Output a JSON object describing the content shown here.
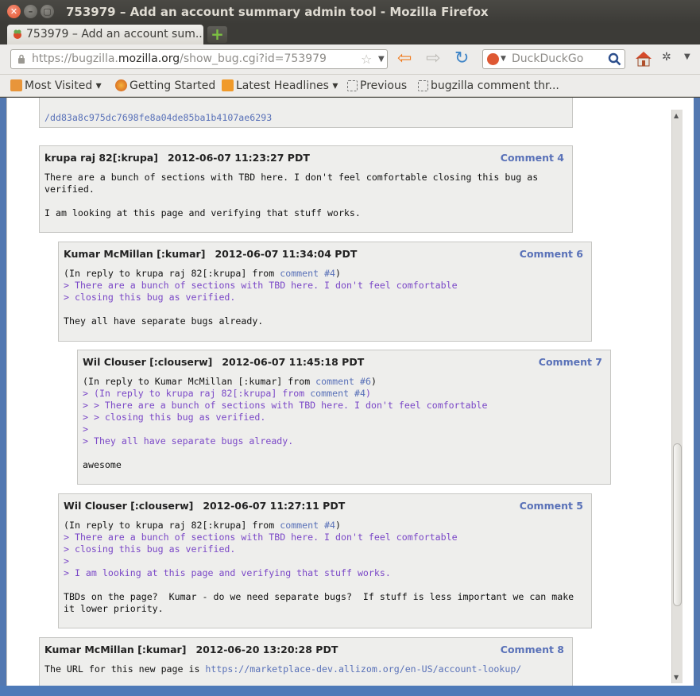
{
  "window": {
    "title": "753979 – Add an account summary admin tool - Mozilla Firefox",
    "close_glyph": "✕",
    "min_glyph": "–",
    "max_glyph": "▢"
  },
  "tabs": [
    {
      "label": "753979 – Add an account sum..."
    }
  ],
  "new_tab_glyph": "+",
  "navbar": {
    "url_prefix": "https://bugzilla.",
    "url_domain": "mozilla.org",
    "url_path": "/show_bug.cgi?id=753979",
    "search_placeholder": "DuckDuckGo"
  },
  "bookmarks": [
    {
      "label": "Most Visited ▾",
      "icon": "rss-folder-icon"
    },
    {
      "label": "Getting Started",
      "icon": "firefox-icon"
    },
    {
      "label": "Latest Headlines ▾",
      "icon": "rss-icon"
    },
    {
      "label": "Previous",
      "icon": "page-icon"
    },
    {
      "label": "bugzilla comment thr...",
      "icon": "page-icon"
    }
  ],
  "partial_link": "/dd83a8c975dc7698fe8a04de85ba1b4107ae6293",
  "comments": [
    {
      "author": "krupa raj 82[:krupa]",
      "datetime": "2012-06-07 11:23:27 PDT",
      "number": "Comment 4",
      "lines": [
        "There are a bunch of sections with TBD here. I don't feel comfortable closing this bug as",
        "verified.",
        "",
        "I am looking at this page and verifying that stuff works."
      ]
    },
    {
      "author": "Kumar McMillan [:kumar]",
      "datetime": "2012-06-07 11:34:04 PDT",
      "number": "Comment 6",
      "reply_prefix": "(In reply to krupa raj 82[:krupa] from ",
      "reply_link": "comment #4",
      "reply_suffix": ")",
      "quotes": [
        "> There are a bunch of sections with TBD here. I don't feel comfortable",
        "> closing this bug as verified."
      ],
      "text": "They all have separate bugs already."
    },
    {
      "author": "Wil Clouser [:clouserw]",
      "datetime": "2012-06-07 11:45:18 PDT",
      "number": "Comment 7",
      "reply_prefix": "(In reply to Kumar McMillan [:kumar] from ",
      "reply_link": "comment #6",
      "reply_suffix": ")",
      "quote1_prefix": "> (In reply to krupa raj 82[:krupa] from ",
      "quote1_link": "comment #4",
      "quote1_suffix": ")",
      "quotes": [
        "> > There are a bunch of sections with TBD here. I don't feel comfortable",
        "> > closing this bug as verified.",
        ">",
        "> They all have separate bugs already."
      ],
      "text": "awesome"
    },
    {
      "author": "Wil Clouser [:clouserw]",
      "datetime": "2012-06-07 11:27:11 PDT",
      "number": "Comment 5",
      "reply_prefix": "(In reply to krupa raj 82[:krupa] from ",
      "reply_link": "comment #4",
      "reply_suffix": ")",
      "quotes": [
        "> There are a bunch of sections with TBD here. I don't feel comfortable",
        "> closing this bug as verified.",
        ">",
        "> I am looking at this page and verifying that stuff works."
      ],
      "text1": "TBDs on the page?  Kumar - do we need separate bugs?  If stuff is less important we can make",
      "text2": "it lower priority."
    },
    {
      "author": "Kumar McMillan [:kumar]",
      "datetime": "2012-06-20 13:20:28 PDT",
      "number": "Comment 8",
      "text_prefix": "The URL for this new page is ",
      "url": "https://marketplace-dev.allizom.org/en-US/account-lookup/"
    }
  ],
  "colors": {
    "accent_link": "#5971b8",
    "quote": "#7a47c7",
    "frame_blue": "#5378b1"
  }
}
